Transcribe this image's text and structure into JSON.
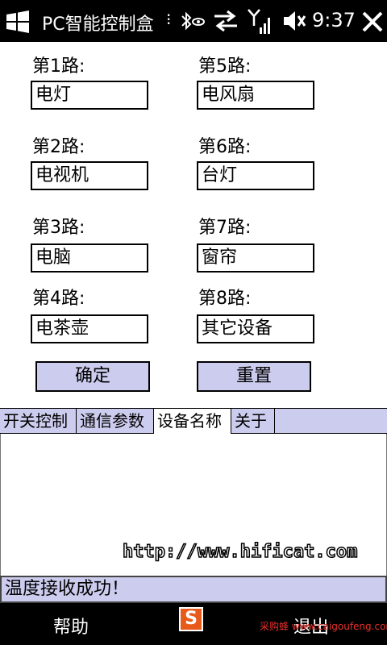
{
  "statusbar": {
    "title": "PC智能控制盒",
    "more_glyph": "⁝",
    "time": "9:37"
  },
  "channels": [
    {
      "label": "第1路:",
      "value": "电灯"
    },
    {
      "label": "第2路:",
      "value": "电视机"
    },
    {
      "label": "第3路:",
      "value": "电脑"
    },
    {
      "label": "第4路:",
      "value": "电茶壶"
    },
    {
      "label": "第5路:",
      "value": "电风扇"
    },
    {
      "label": "第6路:",
      "value": "台灯"
    },
    {
      "label": "第7路:",
      "value": "窗帘"
    },
    {
      "label": "第8路:",
      "value": "其它设备"
    }
  ],
  "buttons": {
    "confirm": "确定",
    "reset": "重置"
  },
  "tabs": [
    {
      "label": "开关控制",
      "active": false
    },
    {
      "label": "通信参数",
      "active": false
    },
    {
      "label": "设备名称",
      "active": true
    },
    {
      "label": "关于",
      "active": false
    }
  ],
  "watermark": "http://www.hificat.com",
  "message": "温度接收成功！",
  "appbar": {
    "left": "帮助",
    "sogou_icon": "S",
    "right": "退出",
    "watermark": "采购蜂 www.caigoufeng.com"
  }
}
